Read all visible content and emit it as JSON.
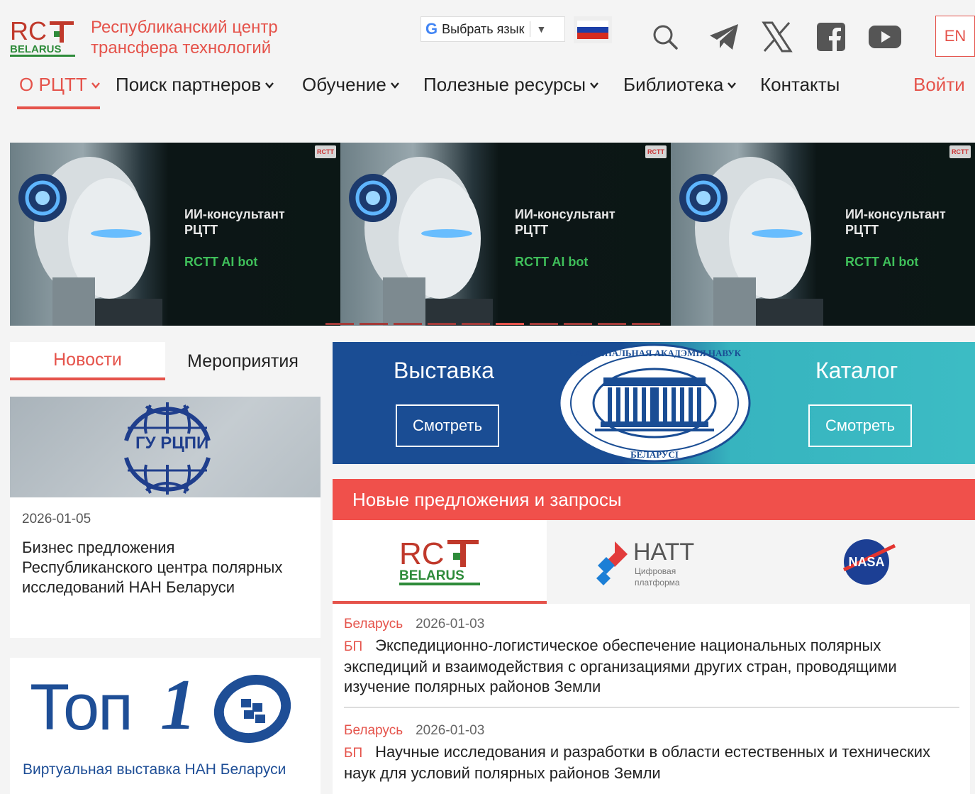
{
  "header": {
    "logo_text": "RCTT BELARUS",
    "org_name_line1": "Республиканский центр",
    "org_name_line2": "трансфера технологий",
    "translate_label": "Выбрать язык",
    "translate_g": "G",
    "translate_arrow": "▼",
    "lang_button": "EN",
    "login": "Войти"
  },
  "nav": {
    "items": [
      {
        "label": "О РЦТТ"
      },
      {
        "label": "Поиск партнеров"
      },
      {
        "label": "Обучение"
      },
      {
        "label": "Полезные ресурсы"
      },
      {
        "label": "Библиотека"
      },
      {
        "label": "Контакты"
      }
    ]
  },
  "banner": {
    "slides": [
      {
        "title_line1": "ИИ-консультант",
        "title_line2": "РЦТТ",
        "subtitle": "RCTT AI bot",
        "badge": "RCTT"
      },
      {
        "title_line1": "ИИ-консультант",
        "title_line2": "РЦТТ",
        "subtitle": "RCTT AI bot",
        "badge": "RCTT"
      },
      {
        "title_line1": "ИИ-консультант",
        "title_line2": "РЦТТ",
        "subtitle": "RCTT AI bot",
        "badge": "RCTT"
      }
    ]
  },
  "tabs": {
    "news": "Новости",
    "events": "Мероприятия"
  },
  "news_card": {
    "image_text": "ГУ РЦПИ",
    "date": "2026-01-05",
    "title": "Бизнес предложения Республиканского центра полярных исследований НАН Беларуси"
  },
  "top10": {
    "big": "Топ",
    "one": "1",
    "subtitle": "Виртуальная выставка НАН Беларуси"
  },
  "promo": {
    "exhibition": "Выставка",
    "catalog": "Каталог",
    "view1": "Смотреть",
    "view2": "Смотреть",
    "seal_text_top": "НАЦЫЯНАЛЬНАЯ АКАДЭМІЯ НАВУК",
    "seal_text_bottom": "БЕЛАРУСІ"
  },
  "offers": {
    "header": "Новые предложения и запросы",
    "partners": {
      "natt_name": "НАТТ",
      "natt_sub1": "Цифровая",
      "natt_sub2": "платформа",
      "nasa": "NASA"
    },
    "items": [
      {
        "country": "Беларусь",
        "date": "2026-01-03",
        "tag": "БП",
        "text": "Экспедиционно-логистическое обеспечение национальных полярных экспедиций и взаимодействия с организациями других стран, проводящими изучение полярных районов Земли"
      },
      {
        "country": "Беларусь",
        "date": "2026-01-03",
        "tag": "БП",
        "text": "Научные исследования и разработки в области естественных и технических наук для условий полярных районов Земли"
      }
    ]
  },
  "colors": {
    "accent": "#e5534b",
    "brand_blue": "#1a4d94",
    "brand_teal": "#3cbcc4"
  }
}
